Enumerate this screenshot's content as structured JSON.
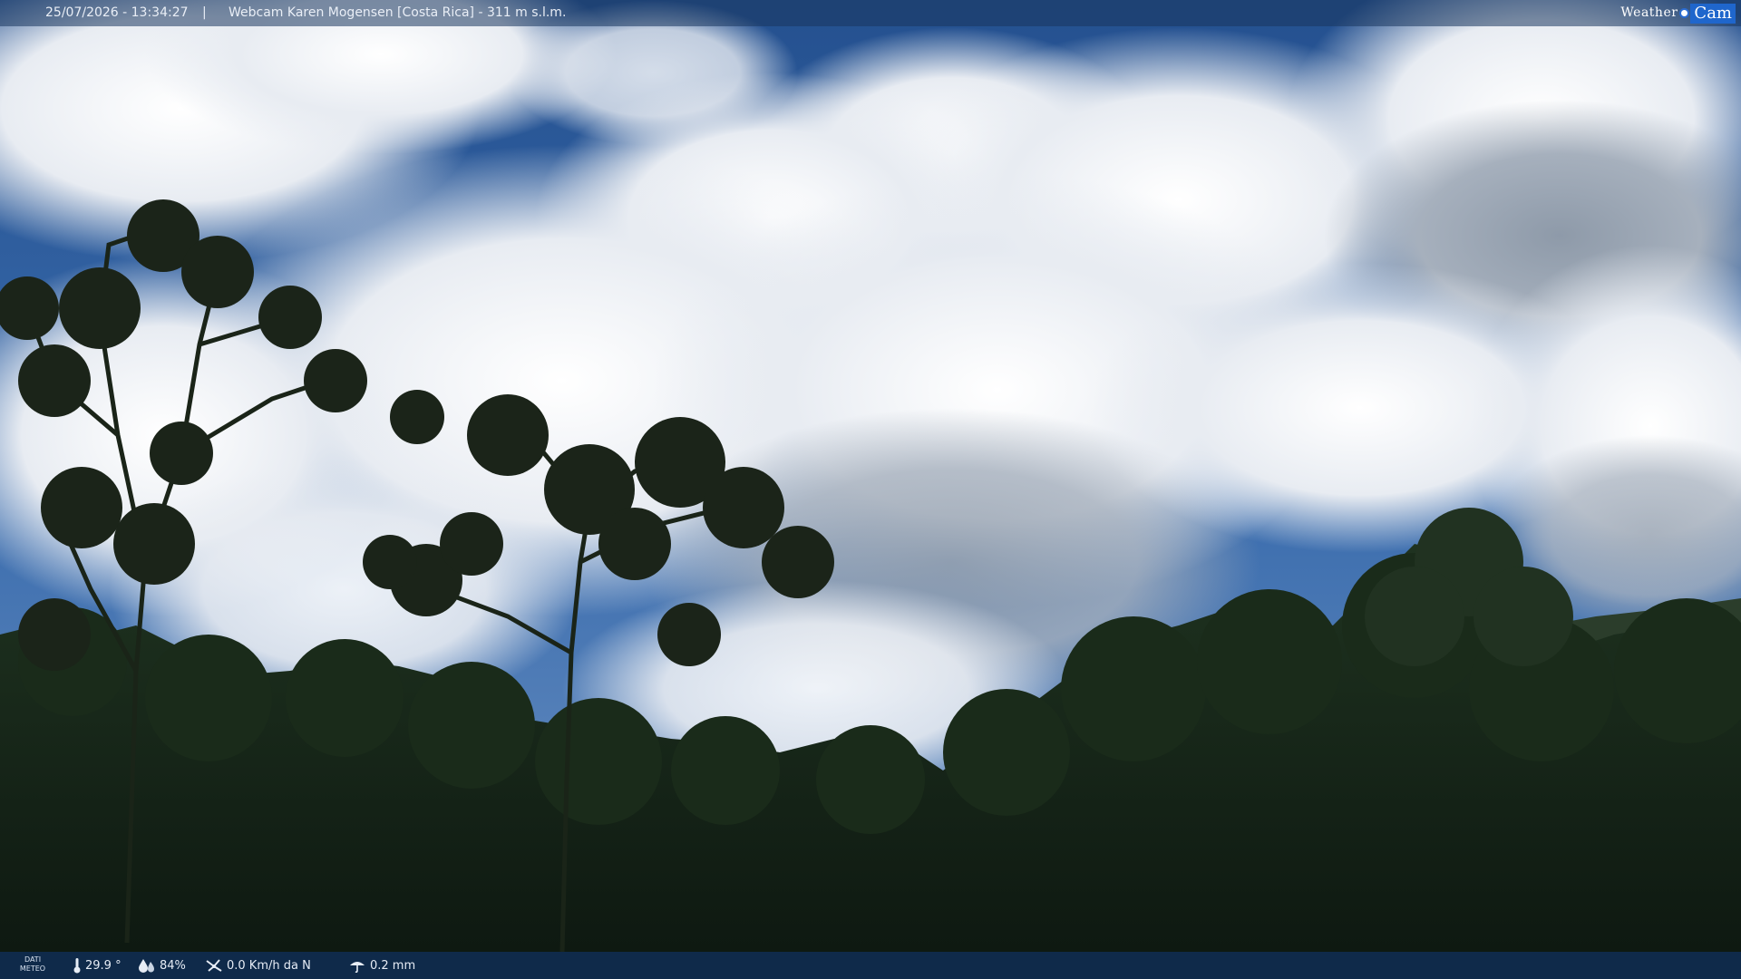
{
  "header": {
    "datetime": "25/07/2026 - 13:34:27",
    "separator": "|",
    "title": "Webcam Karen Mogensen [Costa Rica]  - 311 m s.l.m."
  },
  "logo": {
    "part1": "Weather",
    "part2": "Cam"
  },
  "footer": {
    "label_line1": "DATI",
    "label_line2": "METEO",
    "temperature": "29.9 °",
    "humidity": "84%",
    "wind": "0.0 Km/h da N",
    "rain": "0.2 mm"
  },
  "icons": {
    "temperature": "thermometer-icon",
    "humidity": "humidity-drop-icon",
    "wind": "wind-icon",
    "rain": "rain-gauge-icon"
  },
  "colors": {
    "sky": "#2f5f9e",
    "cloud": "#f2f4f7",
    "vegetation": "#1b2a18",
    "bar": "#0f2a4a"
  }
}
